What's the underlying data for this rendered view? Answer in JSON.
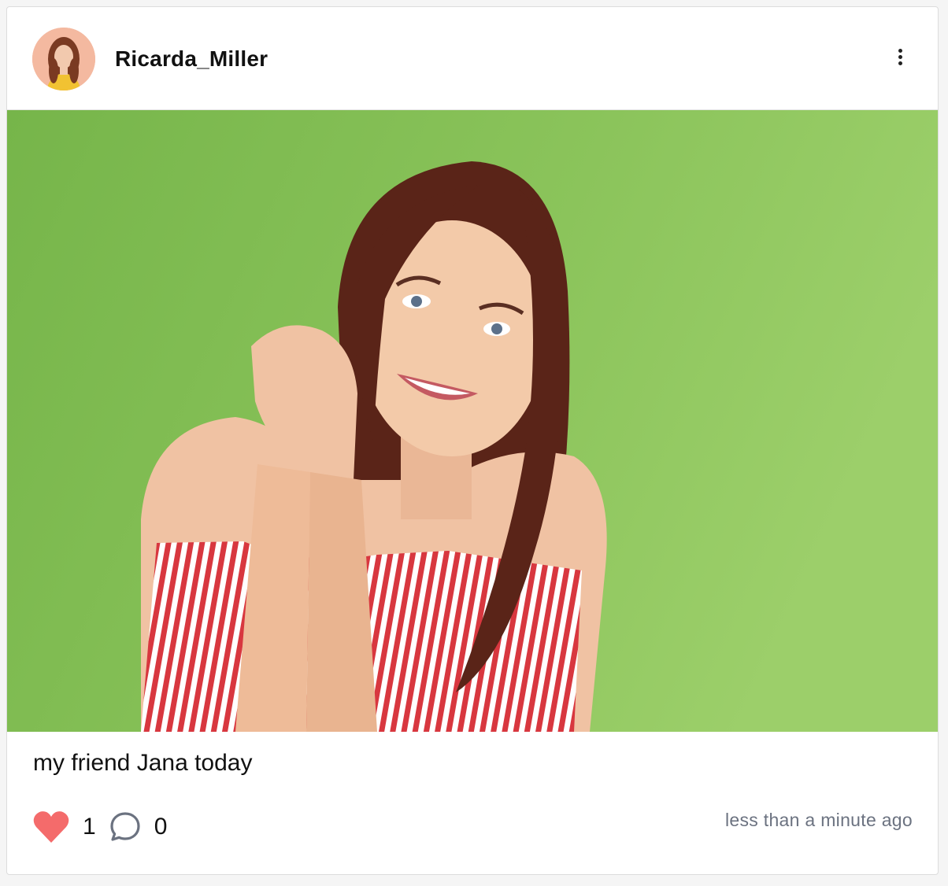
{
  "post": {
    "username": "Ricarda_Miller",
    "caption": "my friend Jana today",
    "likes": "1",
    "comments": "0",
    "timestamp": "less than a minute ago",
    "liked": true
  },
  "icons": {
    "menu": "more-vertical-icon",
    "like": "heart-icon",
    "comment": "speech-bubble-icon"
  },
  "colors": {
    "heart": "#f46b6b",
    "photo_background": "#86c057",
    "avatar_background": "#f4b9a0",
    "timestamp": "#6b7280"
  }
}
